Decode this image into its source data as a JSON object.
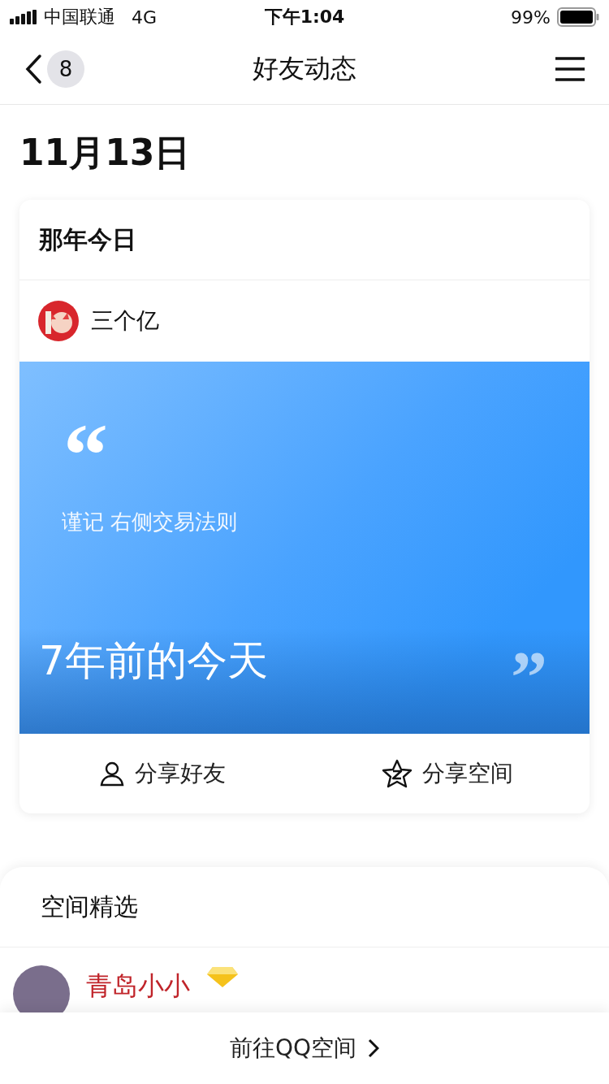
{
  "status_bar": {
    "carrier": "中国联通",
    "network": "4G",
    "time": "下午1:04",
    "battery": "99%"
  },
  "nav": {
    "badge": "8",
    "title": "好友动态"
  },
  "date": "11月13日",
  "memory_card": {
    "title": "那年今日",
    "user": "三个亿",
    "open_quote": "“",
    "text": "谨记 右侧交易法则",
    "caption": "7年前的今天",
    "close_quote": "”",
    "actions": [
      {
        "kind": "friend",
        "label": "分享好友"
      },
      {
        "kind": "space",
        "label": "分享空间"
      }
    ]
  },
  "featured": {
    "title": "空间精选",
    "post": {
      "name": "青岛小小"
    }
  },
  "footer": {
    "label": "前往QQ空间"
  }
}
